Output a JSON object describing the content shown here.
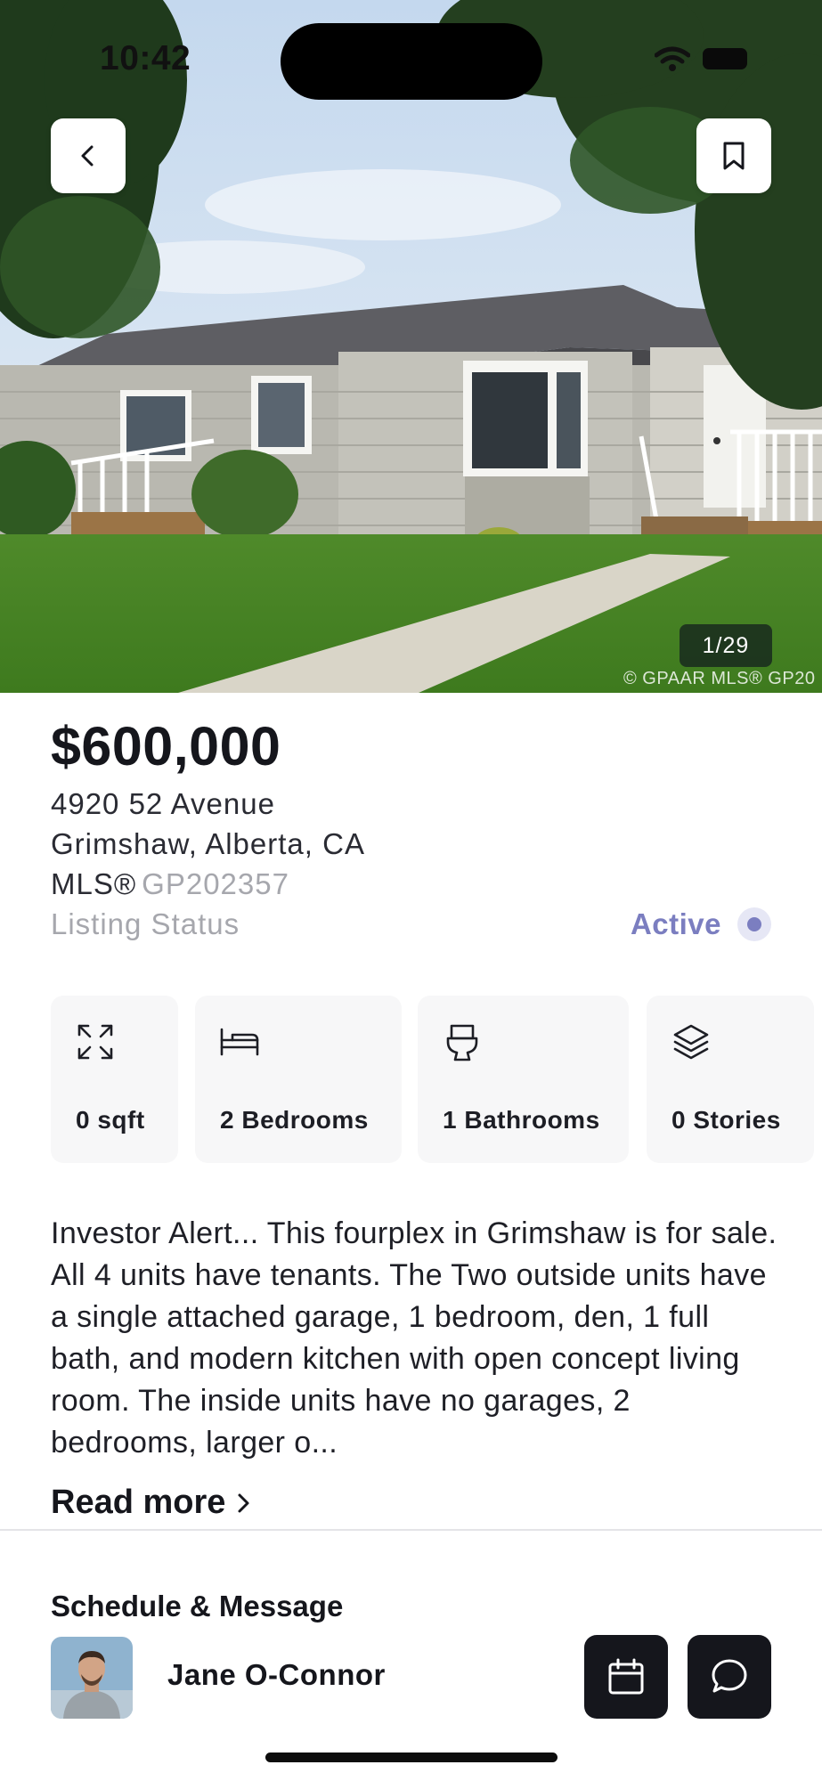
{
  "status_bar": {
    "time": "10:42"
  },
  "gallery": {
    "counter": "1/29",
    "watermark": "© GPAAR MLS® GP20"
  },
  "listing": {
    "price": "$600,000",
    "address_line1": "4920 52 Avenue",
    "address_line2": "Grimshaw, Alberta, CA",
    "mls_label": "MLS®",
    "mls_number": "GP202357",
    "status_label": "Listing Status",
    "status_value": "Active",
    "status_color": "#7b7ec0"
  },
  "features": [
    {
      "icon": "expand-icon",
      "label": "0 sqft"
    },
    {
      "icon": "bed-icon",
      "label": "2 Bedrooms"
    },
    {
      "icon": "toilet-icon",
      "label": "1 Bathrooms"
    },
    {
      "icon": "layers-icon",
      "label": "0 Stories"
    }
  ],
  "description": {
    "text": "Investor Alert... This fourplex in Grimshaw is for sale. All 4 units have tenants. The Two outside units have a single attached garage, 1 bedroom, den, 1 full bath, and modern kitchen with open concept living room. The inside units have no garages, 2 bedrooms, larger o...",
    "read_more": "Read more"
  },
  "contact": {
    "title": "Schedule & Message",
    "agent_name": "Jane O-Connor"
  },
  "icons": {
    "back": "chevron-left-icon",
    "bookmark": "bookmark-icon",
    "calendar": "calendar-icon",
    "message": "chat-bubble-icon"
  },
  "colors": {
    "dark_button": "#15161c",
    "accent": "#7b7ec0"
  }
}
